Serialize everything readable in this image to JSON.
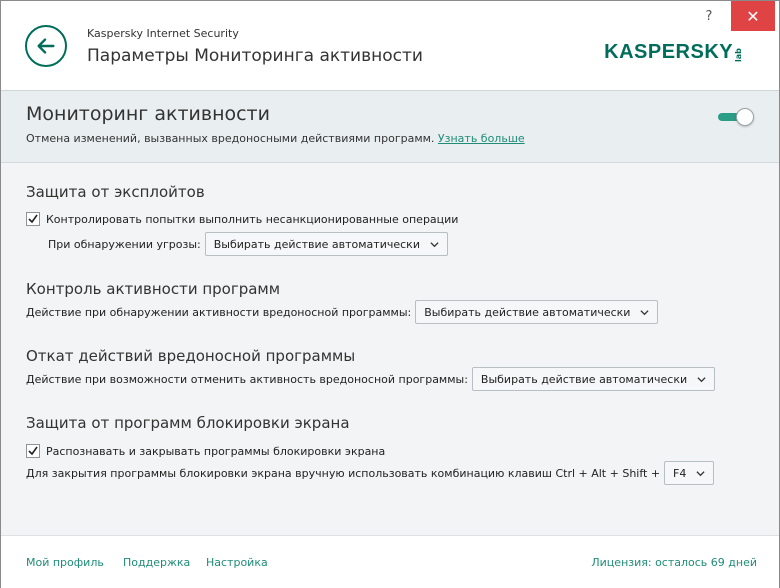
{
  "app": {
    "name": "Kaspersky Internet Security",
    "page_title": "Параметры Мониторинга активности",
    "logo_text": "KASPERSKY",
    "logo_sub": "lab",
    "help_label": "?",
    "close_label": "✕"
  },
  "feature": {
    "title": "Мониторинг активности",
    "description": "Отмена изменений, вызванных вредоносными действиями программ.",
    "learn_more": "Узнать больше",
    "enabled": true
  },
  "sections": {
    "exploit": {
      "title": "Защита от эксплойтов",
      "checkbox_label": "Контролировать попытки выполнить несанкционированные операции",
      "checked": true,
      "action_label": "При обнаружении угрозы:",
      "action_value": "Выбирать действие автоматически"
    },
    "app_control": {
      "title": "Контроль активности программ",
      "action_label": "Действие при обнаружении активности вредоносной программы:",
      "action_value": "Выбирать действие автоматически"
    },
    "rollback": {
      "title": "Откат действий вредоносной программы",
      "action_label": "Действие при возможности отменить активность вредоносной программы:",
      "action_value": "Выбирать действие автоматически"
    },
    "screen_lockers": {
      "title": "Защита от программ блокировки экрана",
      "checkbox_label": "Распознавать и закрывать программы блокировки экрана",
      "checked": true,
      "hotkey_label": "Для закрытия программы блокировки экрана вручную использовать комбинацию клавиш Ctrl + Alt + Shift +",
      "hotkey_value": "F4"
    }
  },
  "footer": {
    "profile": "Мой профиль",
    "support": "Поддержка",
    "settings": "Настройка",
    "license": "Лицензия: осталось 69 дней"
  },
  "colors": {
    "accent": "#1f8c78",
    "brand": "#006d5b",
    "close": "#e04343"
  }
}
